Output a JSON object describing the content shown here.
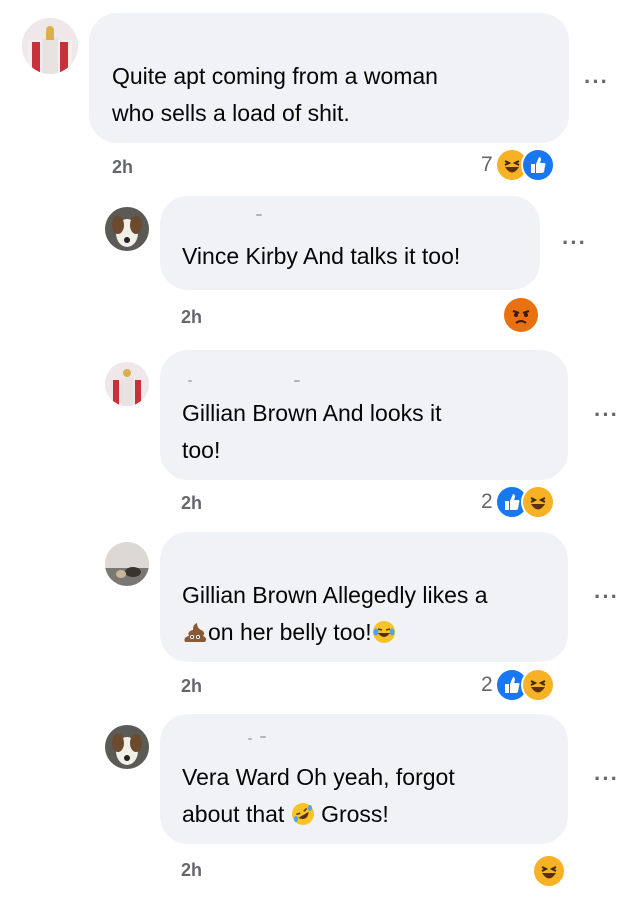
{
  "comments": [
    {
      "text_lines": [
        "Quite apt coming from a woman",
        "who sells a load of shit."
      ],
      "time": "2h",
      "reaction_count": "7",
      "reactions": [
        "haha-icon",
        "like-icon"
      ]
    },
    {
      "text_lines": [
        "Vince Kirby And talks it too!"
      ],
      "time": "2h",
      "reaction_count": "",
      "reactions": [
        "angry-icon"
      ]
    },
    {
      "text_lines": [
        "Gillian Brown And looks it",
        "too!"
      ],
      "time": "2h",
      "reaction_count": "2",
      "reactions": [
        "like-icon",
        "haha-icon"
      ]
    },
    {
      "text_lines": [
        "Gillian Brown Allegedly likes a",
        "on her belly too!"
      ],
      "time": "2h",
      "reaction_count": "2",
      "reactions": [
        "like-icon",
        "haha-icon"
      ]
    },
    {
      "text_lines": [
        "Vera Ward Oh yeah, forgot",
        "about that",
        "Gross!"
      ],
      "time": "2h",
      "reaction_count": "",
      "reactions": [
        "haha-icon"
      ]
    }
  ],
  "more_glyph": "···",
  "colors": {
    "bubble": "#f0f2f5",
    "meta_text": "#65676b",
    "like": "#1877f2",
    "haha": "#f7b125",
    "angry": "#e9710f"
  }
}
